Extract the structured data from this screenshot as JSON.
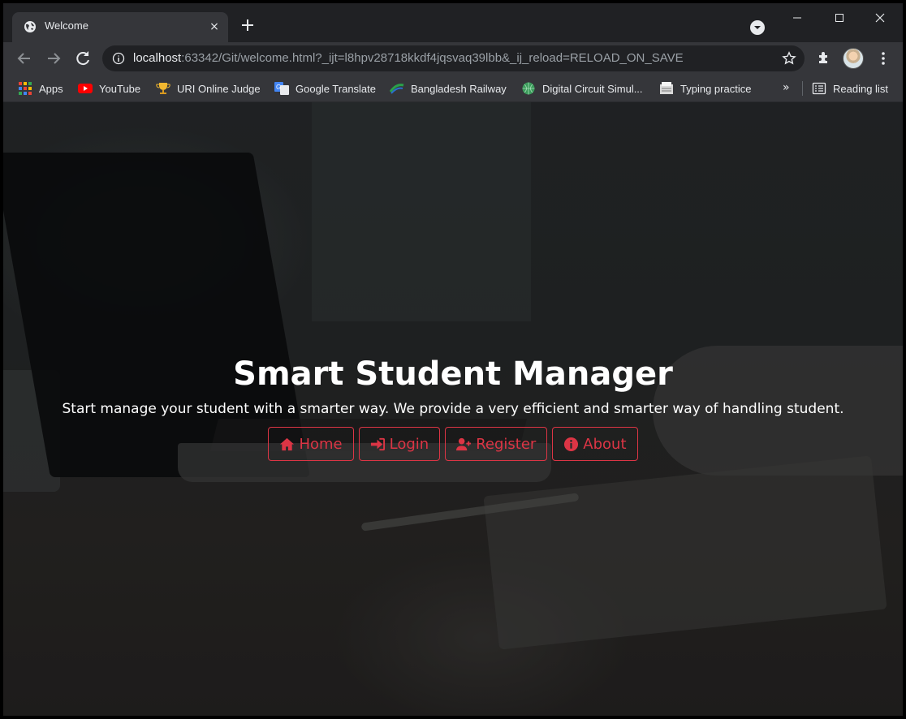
{
  "browser": {
    "tab": {
      "title": "Welcome",
      "close_glyph": "×",
      "favicon": "globe-icon"
    },
    "new_tab_glyph": "+",
    "window_controls": [
      "minimize-icon",
      "maximize-icon",
      "close-icon"
    ],
    "address_bar": {
      "host": "localhost",
      "rest": ":63342/Git/welcome.html?_ijt=l8hpv28718kkdf4jqsvaq39lbb&_ij_reload=RELOAD_ON_SAVE"
    },
    "bookmarks": [
      {
        "label": "Apps",
        "icon": "apps-grid-icon"
      },
      {
        "label": "YouTube",
        "icon": "youtube-icon"
      },
      {
        "label": "URI Online Judge",
        "icon": "trophy-icon"
      },
      {
        "label": "Google Translate",
        "icon": "translate-icon"
      },
      {
        "label": "Bangladesh Railway",
        "icon": "railway-icon"
      },
      {
        "label": "Digital Circuit Simul...",
        "icon": "globe-icon"
      },
      {
        "label": "Typing practice",
        "icon": "typing-icon"
      }
    ],
    "bookmarks_more": "»",
    "reading_list": "Reading list"
  },
  "page": {
    "title": "Smart Student Manager",
    "subtitle": "Start manage your student with a smarter way. We provide a very efficient and smarter way of handling student.",
    "buttons": [
      {
        "label": "Home",
        "icon": "home-icon"
      },
      {
        "label": "Login",
        "icon": "sign-in-icon"
      },
      {
        "label": "Register",
        "icon": "user-plus-icon"
      },
      {
        "label": "About",
        "icon": "info-circle-icon"
      }
    ],
    "accent_color": "#dc3545"
  }
}
